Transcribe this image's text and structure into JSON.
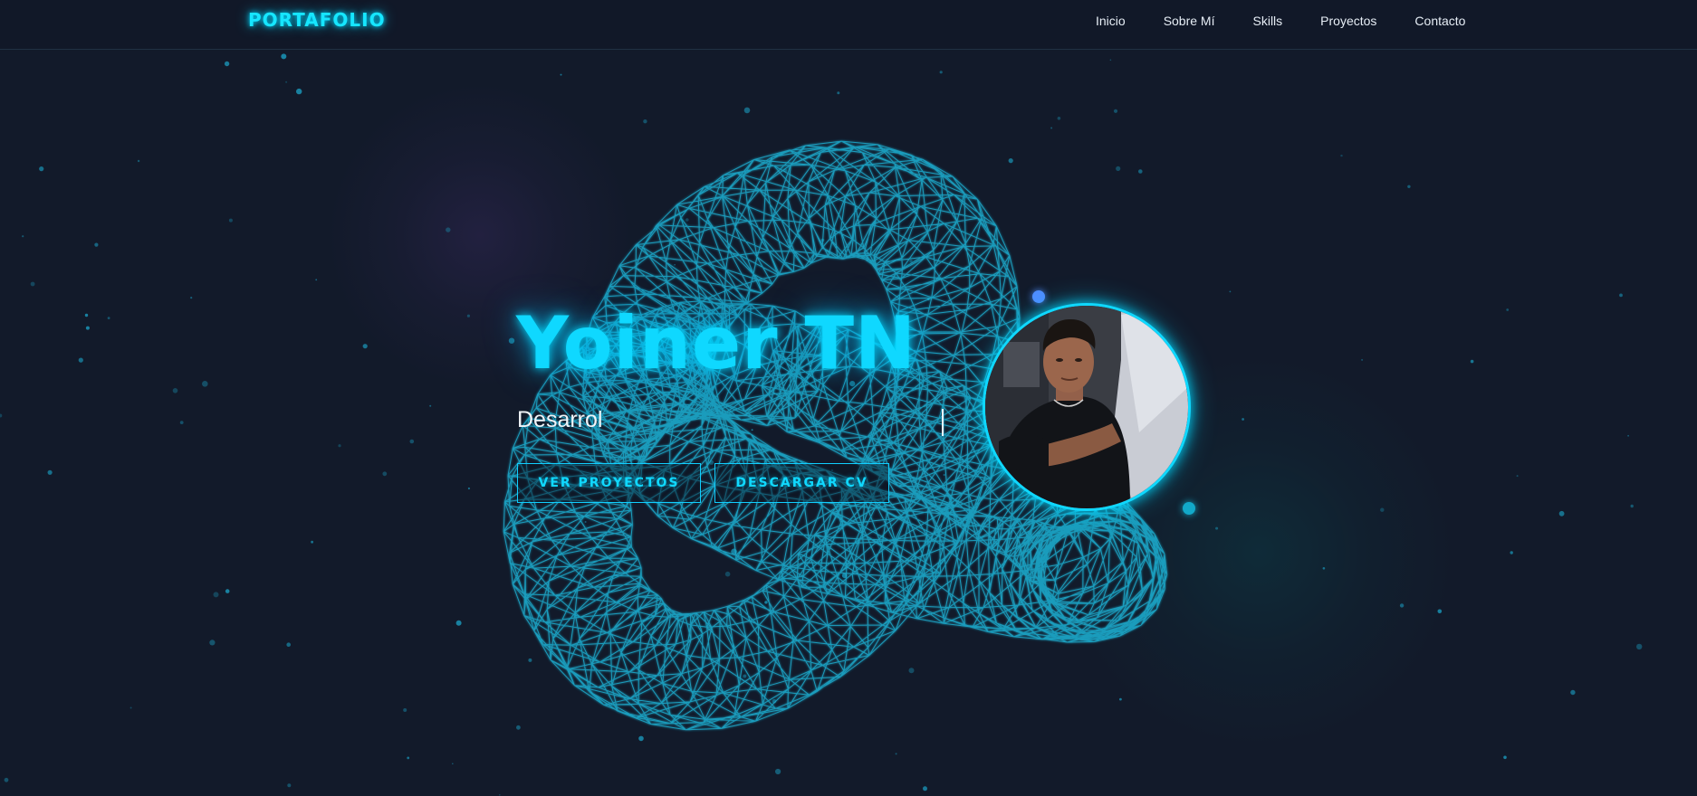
{
  "nav": {
    "logo": "PORTAFOLIO",
    "links": [
      "Inicio",
      "Sobre Mí",
      "Skills",
      "Proyectos",
      "Contacto"
    ]
  },
  "hero": {
    "name": "Yoiner TN",
    "subtitle": "Desarrol",
    "buttons": {
      "projects": "VER PROYECTOS",
      "cv": "DESCARGAR CV"
    }
  },
  "colors": {
    "background": "#121a2a",
    "accent": "#0fd8ff",
    "mesh": "#1fb3d6",
    "text": "#f0f4f8"
  },
  "icons": [
    "wireframe-knot",
    "profile-photo",
    "particle-dots"
  ]
}
